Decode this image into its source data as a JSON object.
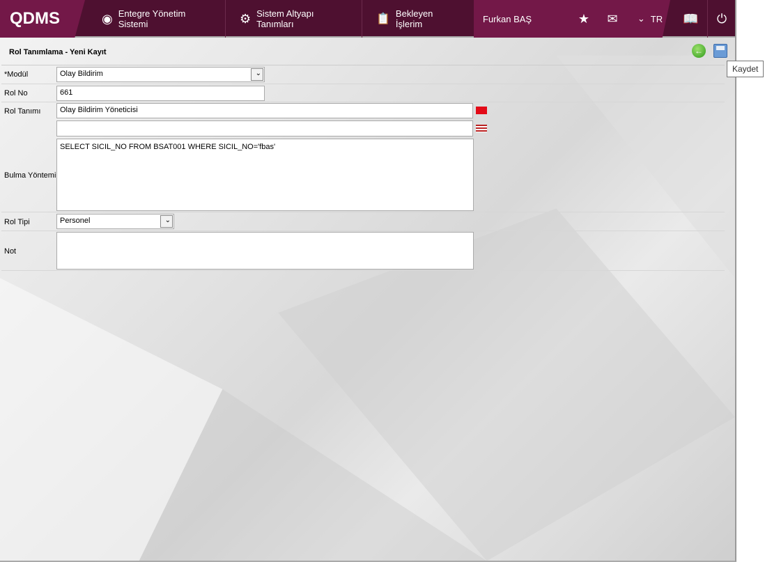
{
  "header": {
    "logo": "QDMS",
    "nav": [
      "Entegre Yönetim Sistemi",
      "Sistem Altyapı Tanımları",
      "Bekleyen İşlerim"
    ],
    "user": "Furkan BAŞ",
    "lang": "TR"
  },
  "page": {
    "title": "Rol Tanımlama - Yeni Kayıt",
    "save_tooltip": "Kaydet"
  },
  "form": {
    "modul_label": "*Modül",
    "modul_value": "Olay Bildirim",
    "rolno_label": "Rol No",
    "rolno_value": "661",
    "roltanimi_label": "Rol Tanımı",
    "roltanimi_tr": "Olay Bildirim Yöneticisi",
    "roltanimi_en": "",
    "bulma_label": "Bulma Yöntemi",
    "bulma_value": "SELECT SICIL_NO FROM BSAT001 WHERE SICIL_NO='fbas'",
    "roltipi_label": "Rol Tipi",
    "roltipi_value": "Personel",
    "not_label": "Not",
    "not_value": ""
  }
}
